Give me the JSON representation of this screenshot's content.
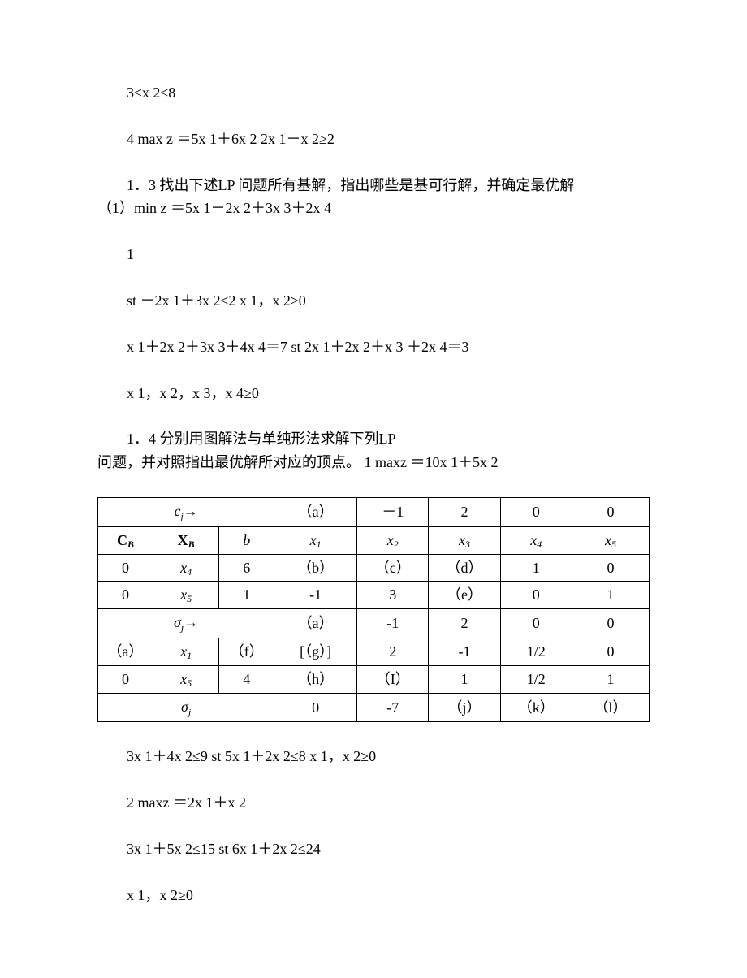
{
  "p1": "3≤x 2≤8",
  "p2": "4 max z ＝5x 1＋6x 2 2x 1－x 2≥2",
  "p3a": "1．3 找出下述LP 问题所有基解，指出哪些是基可行解，并确定最优解",
  "p3b": "（1）min z ＝5x 1－2x 2＋3x 3＋2x 4",
  "p4": "1",
  "p5": "st －2x 1＋3x 2≤2 x 1，x 2≥0",
  "p6": "x 1＋2x 2＋3x 3＋4x 4＝7 st 2x 1＋2x 2＋x 3 ＋2x 4＝3",
  "p7": "x 1，x 2，x 3，x 4≥0",
  "p8a": "1．4 分别用图解法与单纯形法求解下列LP",
  "p8b": "问题，并对照指出最优解所对应的顶点。 1 maxz ＝10x 1＋5x 2",
  "p9": "3x 1＋4x 2≤9 st 5x 1＋2x 2≤8 x 1，x 2≥0",
  "p10": "2 maxz ＝2x 1＋x 2",
  "p11": "3x 1＋5x 2≤15 st 6x 1＋2x 2≤24",
  "p12": "x 1，x 2≥0",
  "table": {
    "r0": {
      "c0": "cⱼ→",
      "c3": "（a）",
      "c4": "－1",
      "c5": "2",
      "c6": "0",
      "c7": "0"
    },
    "r1": {
      "c0": "C_B",
      "c1": "X_B",
      "c2": "b",
      "c3": "x₁",
      "c4": "x₂",
      "c5": "x₃",
      "c6": "x₄",
      "c7": "x₅"
    },
    "r2": {
      "c0": "0",
      "c1": "x₄",
      "c2": "6",
      "c3": "（b）",
      "c4": "（c）",
      "c5": "（d）",
      "c6": "1",
      "c7": "0"
    },
    "r3": {
      "c0": "0",
      "c1": "x₅",
      "c2": "1",
      "c3": "-1",
      "c4": "3",
      "c5": "（e）",
      "c6": "0",
      "c7": "1"
    },
    "r4": {
      "c0": "σⱼ→",
      "c3": "（a）",
      "c4": "-1",
      "c5": "2",
      "c6": "0",
      "c7": "0"
    },
    "r5": {
      "c0": "（a）",
      "c1": "x₁",
      "c2": "（f）",
      "c3": "[（g）]",
      "c4": "2",
      "c5": "-1",
      "c6": "1/2",
      "c7": "0"
    },
    "r6": {
      "c0": "0",
      "c1": "x₅",
      "c2": "4",
      "c3": "（h）",
      "c4": "（I）",
      "c5": "1",
      "c6": "1/2",
      "c7": "1"
    },
    "r7": {
      "c0": "σⱼ",
      "c3": "0",
      "c4": "-7",
      "c5": "（j）",
      "c6": "（k）",
      "c7": "（l）"
    }
  }
}
